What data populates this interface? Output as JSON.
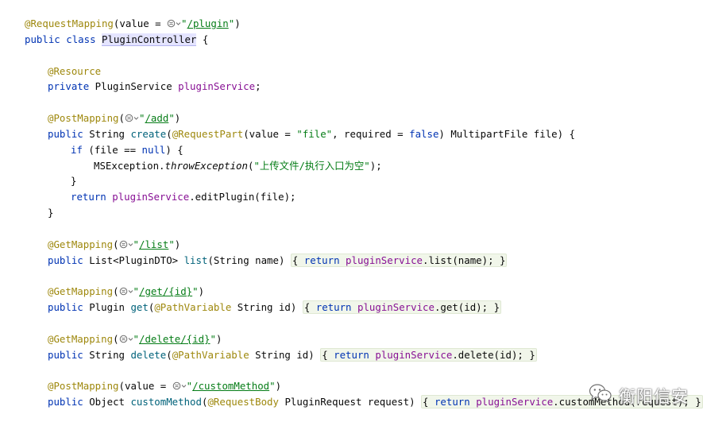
{
  "editor": {
    "lines": {
      "l1": {
        "ann": "@RequestMapping",
        "p1": "(value = ",
        "url": "/plugin",
        "p2": ")"
      },
      "l2": {
        "kw1": "public",
        "kw2": "class",
        "name": "PluginController",
        "p1": " {"
      },
      "l4": {
        "ann": "@Resource"
      },
      "l5": {
        "kw": "private",
        "type": " PluginService ",
        "field": "pluginService",
        "p1": ";"
      },
      "l7": {
        "ann": "@PostMapping",
        "p1": "(",
        "url": "/add",
        "p2": ")"
      },
      "l8": {
        "kw": "public",
        "type": " String ",
        "method": "create",
        "p1": "(",
        "ann": "@RequestPart",
        "p2": "(value = ",
        "str1": "\"file\"",
        "p3": ", required = ",
        "kw2": "false",
        "p4": ") MultipartFile file) {"
      },
      "l9": {
        "kw": "if",
        "p1": " (file == ",
        "kw2": "null",
        "p2": ") {"
      },
      "l10": {
        "p1": "MSException.",
        "static": "throwException",
        "p2": "(",
        "str": "\"上传文件/执行入口为空\"",
        "p3": ");"
      },
      "l11": {
        "p1": "}"
      },
      "l12": {
        "kw": "return",
        "sp": " ",
        "field": "pluginService",
        "p1": ".editPlugin(file);"
      },
      "l13": {
        "p1": "}"
      },
      "l15": {
        "ann": "@GetMapping",
        "p1": "(",
        "url": "/list",
        "p2": ")"
      },
      "l16": {
        "kw": "public",
        "type": " List<PluginDTO> ",
        "method": "list",
        "p1": "(String name) ",
        "f_open": "{ ",
        "kw2": "return",
        "sp": " ",
        "field": "pluginService",
        "p2": ".list(name); ",
        "f_close": "}"
      },
      "l18": {
        "ann": "@GetMapping",
        "p1": "(",
        "url": "/get/{id}",
        "p2": ")"
      },
      "l19": {
        "kw": "public",
        "type": " Plugin ",
        "method": "get",
        "p1": "(",
        "ann": "@PathVariable",
        "p2": " String id) ",
        "f_open": "{ ",
        "kw2": "return",
        "sp": " ",
        "field": "pluginService",
        "p3": ".get(id); ",
        "f_close": "}"
      },
      "l21": {
        "ann": "@GetMapping",
        "p1": "(",
        "url": "/delete/{id}",
        "p2": ")"
      },
      "l22": {
        "kw": "public",
        "type": " String ",
        "method": "delete",
        "p1": "(",
        "ann": "@PathVariable",
        "p2": " String id) ",
        "f_open": "{ ",
        "kw2": "return",
        "sp": " ",
        "field": "pluginService",
        "p3": ".delete(id); ",
        "f_close": "}"
      },
      "l24": {
        "ann": "@PostMapping",
        "p1": "(value = ",
        "url": "/customMethod",
        "p2": ")"
      },
      "l25": {
        "kw": "public",
        "type": " Object ",
        "method": "customMethod",
        "p1": "(",
        "ann": "@RequestBody",
        "p2": " PluginRequest request) ",
        "f_open": "{ ",
        "kw2": "return",
        "sp": " ",
        "field": "pluginService",
        "p3": ".customMethod(request); ",
        "f_close": "}"
      }
    },
    "icons": {
      "url_glyph": "globe-icon",
      "url_chevron": "chevron-down-icon"
    }
  },
  "watermark": {
    "text": "衡阳信安",
    "icon": "wechat-icon"
  },
  "colors": {
    "keyword": "#0033b3",
    "annotation": "#9e880d",
    "string": "#067d17",
    "field": "#871094",
    "method": "#00627a",
    "text": "#080808"
  }
}
